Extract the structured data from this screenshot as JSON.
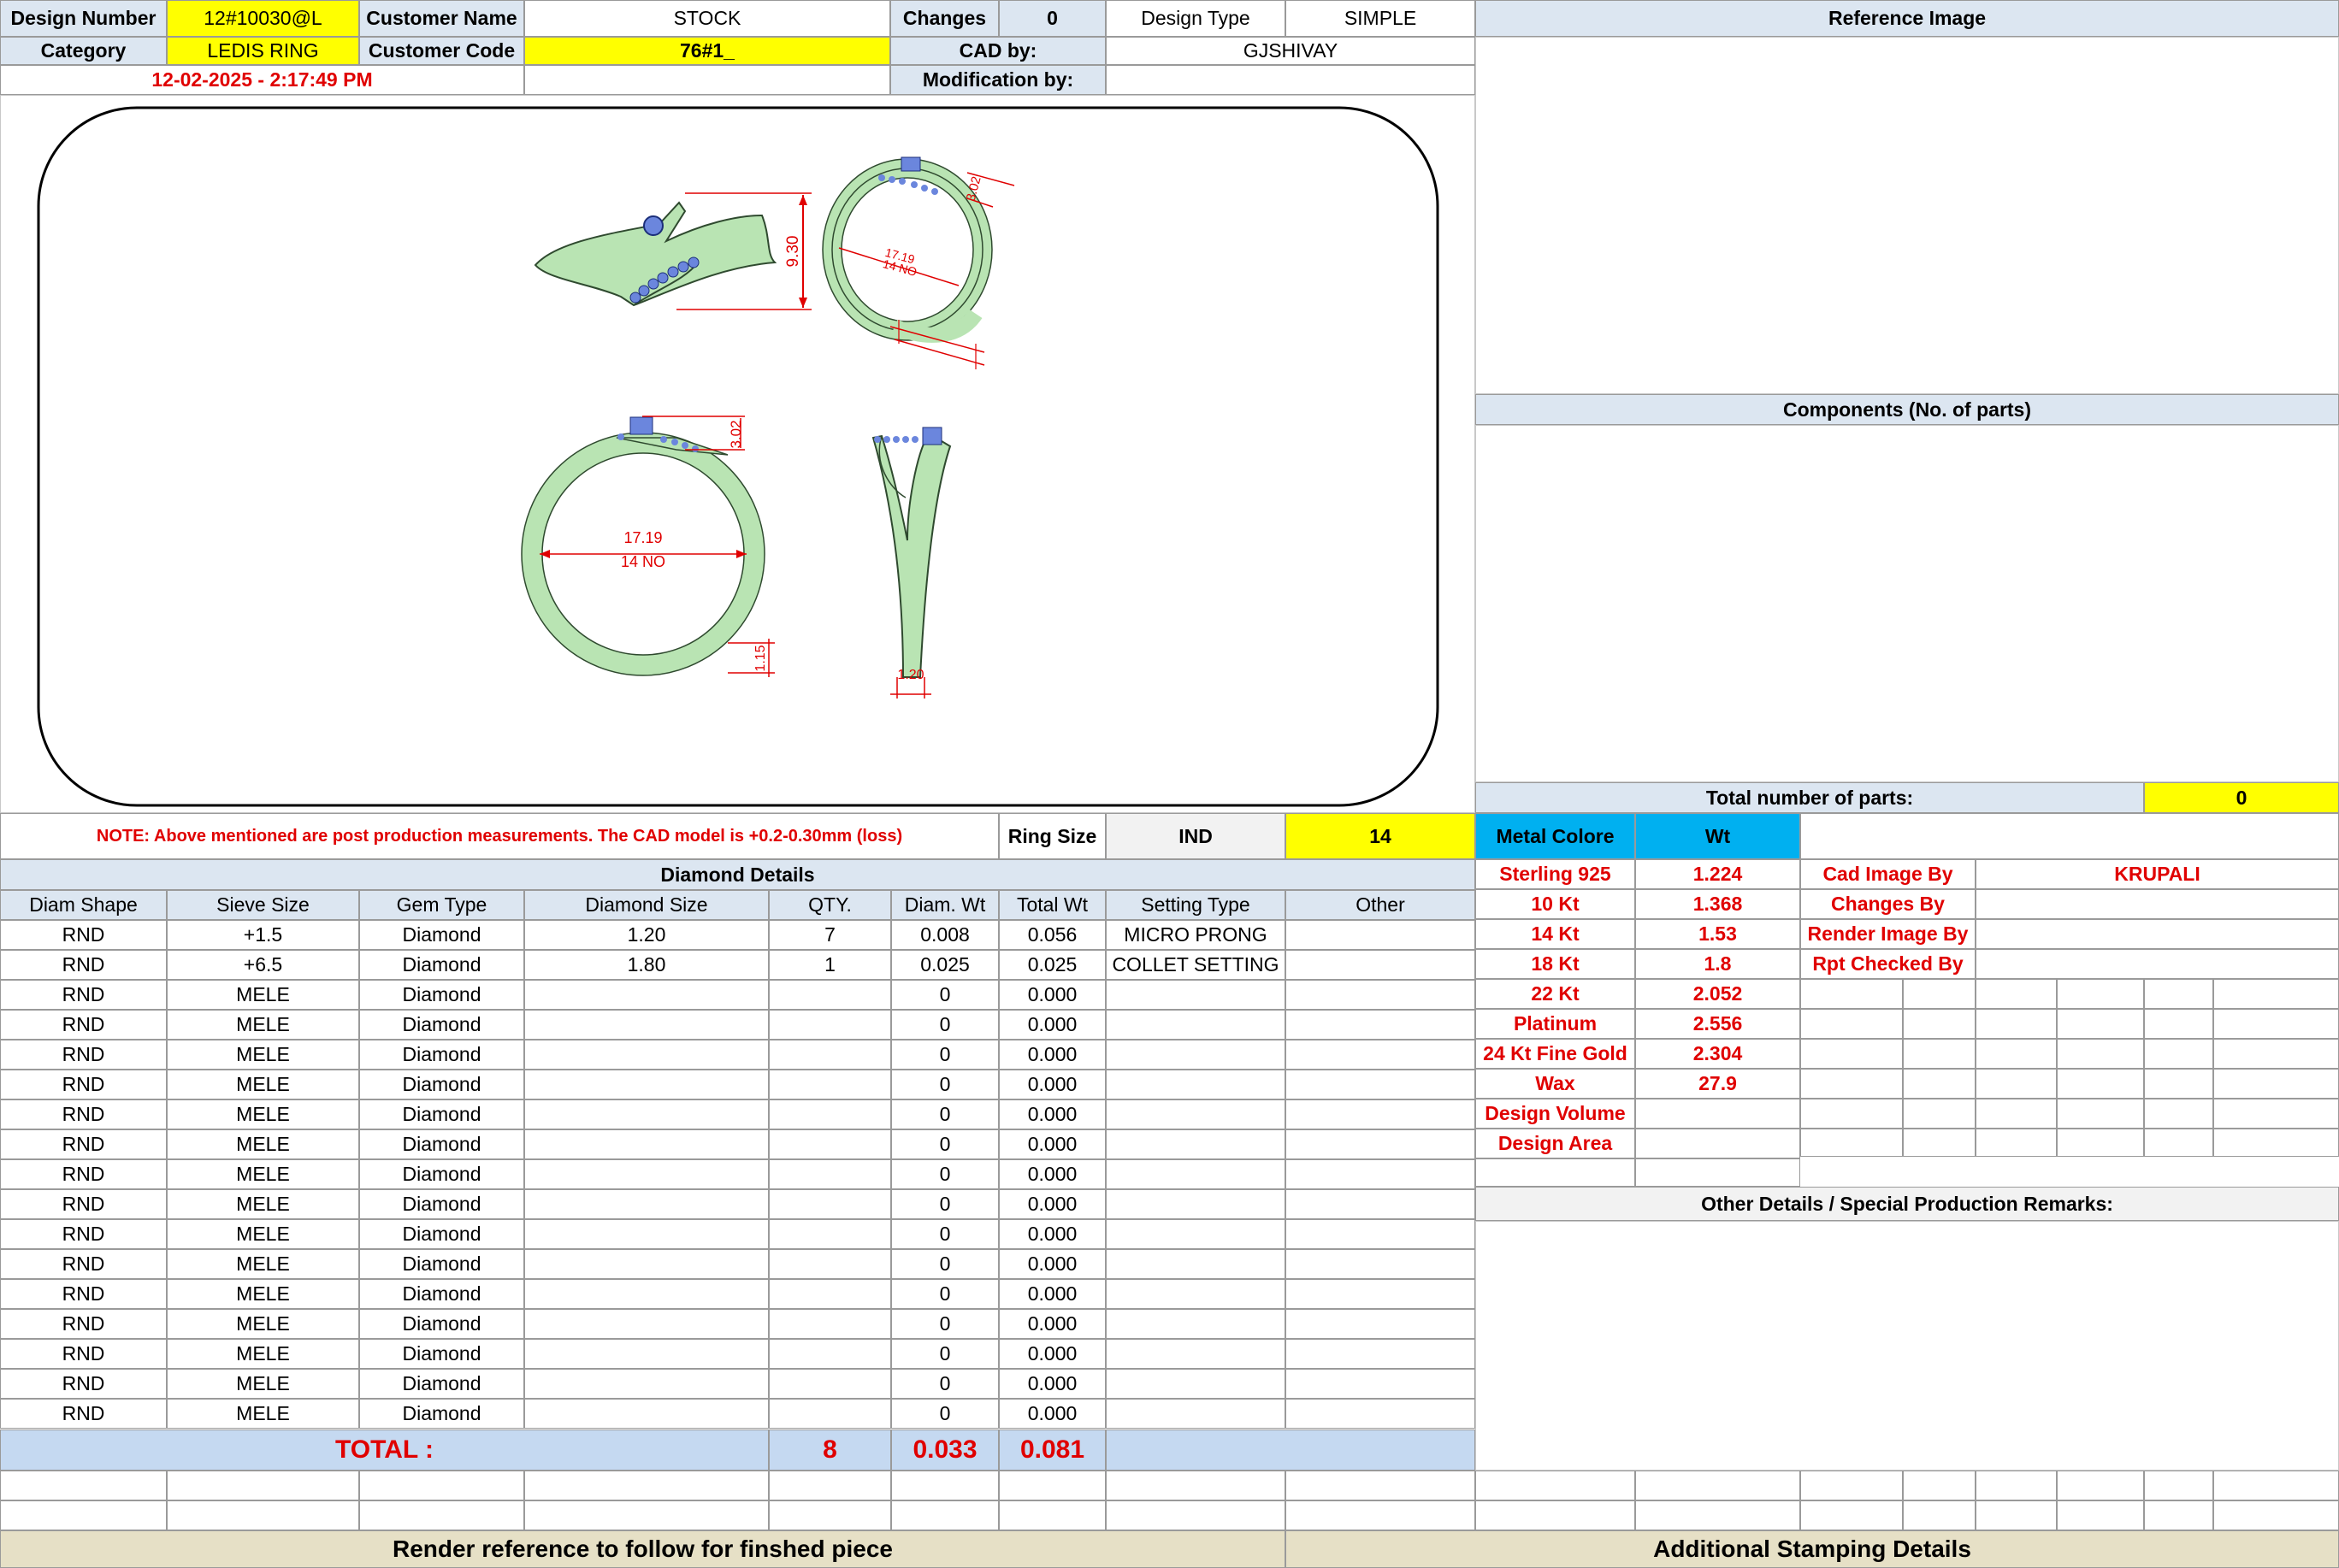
{
  "header": {
    "design_number_label": "Design Number",
    "design_number": "12#10030@L",
    "customer_name_label": "Customer Name",
    "customer_name": "STOCK",
    "changes_label": "Changes",
    "changes": "0",
    "design_type_label": "Design Type",
    "design_type": "SIMPLE",
    "category_label": "Category",
    "category": "LEDIS RING",
    "customer_code_label": "Customer Code",
    "customer_code": "76#1_",
    "cad_by_label": "CAD by:",
    "cad_by": "GJSHIVAY",
    "timestamp": "12-02-2025 - 2:17:49 PM",
    "modification_by_label": "Modification by:"
  },
  "right_panel": {
    "reference_image": "Reference Image",
    "components": "Components (No. of parts)",
    "total_parts_label": "Total number of parts:",
    "total_parts": "0"
  },
  "drawing": {
    "dims": {
      "top_height": "9.30",
      "side_top": "3.02",
      "side_inner": "17.19",
      "side_size": "14 NO",
      "front_top": "3.02",
      "front_inner": "17.19",
      "front_size": "14 NO",
      "front_bottom": "1.15",
      "profile_bottom": "1.20"
    }
  },
  "note": "NOTE: Above mentioned are post production measurements. The CAD model is +0.2-0.30mm (loss)",
  "ring_size": {
    "label": "Ring Size",
    "system": "IND",
    "value": "14"
  },
  "diamond": {
    "title": "Diamond Details",
    "columns": [
      "Diam Shape",
      "Sieve Size",
      "Gem Type",
      "Diamond Size",
      "QTY.",
      "Diam. Wt",
      "Total Wt",
      "Setting Type",
      "Other"
    ],
    "rows": [
      [
        "RND",
        "+1.5",
        "Diamond",
        "1.20",
        "7",
        "0.008",
        "0.056",
        "MICRO PRONG",
        ""
      ],
      [
        "RND",
        "+6.5",
        "Diamond",
        "1.80",
        "1",
        "0.025",
        "0.025",
        "COLLET SETTING",
        ""
      ],
      [
        "RND",
        "MELE",
        "Diamond",
        "",
        "",
        "0",
        "0.000",
        "",
        ""
      ],
      [
        "RND",
        "MELE",
        "Diamond",
        "",
        "",
        "0",
        "0.000",
        "",
        ""
      ],
      [
        "RND",
        "MELE",
        "Diamond",
        "",
        "",
        "0",
        "0.000",
        "",
        ""
      ],
      [
        "RND",
        "MELE",
        "Diamond",
        "",
        "",
        "0",
        "0.000",
        "",
        ""
      ],
      [
        "RND",
        "MELE",
        "Diamond",
        "",
        "",
        "0",
        "0.000",
        "",
        ""
      ],
      [
        "RND",
        "MELE",
        "Diamond",
        "",
        "",
        "0",
        "0.000",
        "",
        ""
      ],
      [
        "RND",
        "MELE",
        "Diamond",
        "",
        "",
        "0",
        "0.000",
        "",
        ""
      ],
      [
        "RND",
        "MELE",
        "Diamond",
        "",
        "",
        "0",
        "0.000",
        "",
        ""
      ],
      [
        "RND",
        "MELE",
        "Diamond",
        "",
        "",
        "0",
        "0.000",
        "",
        ""
      ],
      [
        "RND",
        "MELE",
        "Diamond",
        "",
        "",
        "0",
        "0.000",
        "",
        ""
      ],
      [
        "RND",
        "MELE",
        "Diamond",
        "",
        "",
        "0",
        "0.000",
        "",
        ""
      ],
      [
        "RND",
        "MELE",
        "Diamond",
        "",
        "",
        "0",
        "0.000",
        "",
        ""
      ],
      [
        "RND",
        "MELE",
        "Diamond",
        "",
        "",
        "0",
        "0.000",
        "",
        ""
      ],
      [
        "RND",
        "MELE",
        "Diamond",
        "",
        "",
        "0",
        "0.000",
        "",
        ""
      ],
      [
        "RND",
        "MELE",
        "Diamond",
        "",
        "",
        "0",
        "0.000",
        "",
        ""
      ]
    ],
    "total_label": "TOTAL :",
    "total_qty": "8",
    "total_diam_wt": "0.033",
    "total_wt": "0.081"
  },
  "metal": {
    "colore_label": "Metal Colore",
    "wt_label": "Wt",
    "rows": [
      {
        "name": "Sterling 925",
        "wt": "1.224"
      },
      {
        "name": "10 Kt",
        "wt": "1.368"
      },
      {
        "name": "14 Kt",
        "wt": "1.53"
      },
      {
        "name": "18 Kt",
        "wt": "1.8"
      },
      {
        "name": "22 Kt",
        "wt": "2.052"
      },
      {
        "name": "Platinum",
        "wt": "2.556"
      },
      {
        "name": "24 Kt Fine Gold",
        "wt": "2.304"
      },
      {
        "name": "Wax",
        "wt": "27.9"
      },
      {
        "name": "Design Volume",
        "wt": ""
      },
      {
        "name": "Design Area",
        "wt": ""
      }
    ]
  },
  "staff": [
    {
      "label": "Cad Image By",
      "value": "KRUPALI"
    },
    {
      "label": "Changes By",
      "value": ""
    },
    {
      "label": "Render Image By",
      "value": ""
    },
    {
      "label": "Rpt Checked By",
      "value": ""
    }
  ],
  "remarks_title": "Other Details / Special Production Remarks:",
  "footer": {
    "render_ref": "Render reference to follow for finshed piece",
    "stamping": "Additional Stamping Details"
  },
  "colors": {
    "metal_green": "#b9e4b3",
    "stone_blue": "#6b86dd",
    "dim_red": "#e00000",
    "header_blue": "#dce6f1",
    "highlight_yellow": "#ffff00",
    "wt_cyan": "#00b0f0",
    "footer_tan": "#e6e0c6"
  }
}
